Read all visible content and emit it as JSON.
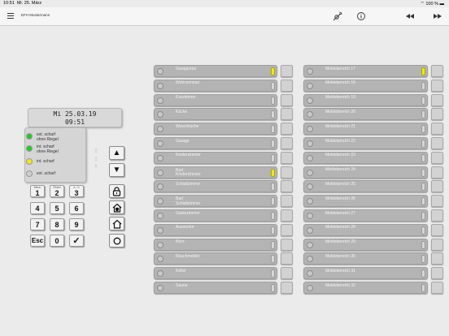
{
  "status_bar": {
    "time": "10:51",
    "date": "Mi. 25. März",
    "battery": "100 %"
  },
  "nav": {
    "title": "EFH Mustermann",
    "icons": [
      "menu-icon",
      "wireless-icon",
      "info-icon",
      "rewind-icon",
      "fast-forward-icon"
    ]
  },
  "lcd": {
    "line1": "Mi 25.03.19",
    "line2": "09:51"
  },
  "status_panel": [
    {
      "label1": "ext. scharf",
      "label2": "ohne Riegel",
      "color": "#22cc22"
    },
    {
      "label1": "int. scharf",
      "label2": "ohne Riegel",
      "color": "#22cc22"
    },
    {
      "label1": "int. scharf",
      "label2": "",
      "color": "#f2e61d"
    },
    {
      "label1": "ext. scharf",
      "label2": "",
      "color": "#cfcfcf"
    }
  ],
  "keypad": {
    "k1": {
      "sub": "Menu",
      "main": "1"
    },
    "k2": {
      "sub": "Reset",
      "main": "2"
    },
    "k3": {
      "sub": "a - b",
      "main": "3"
    },
    "k4": "4",
    "k5": "5",
    "k6": "6",
    "k7": "7",
    "k8": "8",
    "k9": "9",
    "kesc": "Esc",
    "k0": "0",
    "kok": "✓"
  },
  "side_buttons": {
    "up": "▲",
    "down": "▼",
    "lock": "lock-icon",
    "home_shield": "house-shield-icon",
    "home": "house-icon",
    "circle": "circle-icon"
  },
  "zones_left": [
    {
      "label1": "Garagentor",
      "label2": "",
      "indicator": "#f2e61d"
    },
    {
      "label1": "Wohnzimmer",
      "label2": "",
      "indicator": ""
    },
    {
      "label1": "Esszimmer",
      "label2": "",
      "indicator": ""
    },
    {
      "label1": "Küche",
      "label2": "",
      "indicator": ""
    },
    {
      "label1": "Waschküche",
      "label2": "",
      "indicator": ""
    },
    {
      "label1": "Garage",
      "label2": "",
      "indicator": ""
    },
    {
      "label1": "Kinderzimmer",
      "label2": "",
      "indicator": ""
    },
    {
      "label1": "Bad",
      "label2": "Kinderzimmer",
      "indicator": "#f2e61d"
    },
    {
      "label1": "Schlafzimmer",
      "label2": "",
      "indicator": ""
    },
    {
      "label1": "Bad",
      "label2": "Schlafzimmer",
      "indicator": ""
    },
    {
      "label1": "Gästezimmer",
      "label2": "",
      "indicator": ""
    },
    {
      "label1": "Aussentür",
      "label2": "",
      "indicator": ""
    },
    {
      "label1": "Büro",
      "label2": "",
      "indicator": ""
    },
    {
      "label1": "Rauchmelder",
      "label2": "",
      "indicator": ""
    },
    {
      "label1": "Keller",
      "label2": "",
      "indicator": ""
    },
    {
      "label1": "Sauna",
      "label2": "",
      "indicator": ""
    }
  ],
  "zones_right": [
    {
      "label1": "Meldebereich 17",
      "label2": "",
      "indicator": "#f2e61d"
    },
    {
      "label1": "Meldebereich 18",
      "label2": "",
      "indicator": ""
    },
    {
      "label1": "Meldebereich 19",
      "label2": "",
      "indicator": ""
    },
    {
      "label1": "Meldebereich 20",
      "label2": "",
      "indicator": ""
    },
    {
      "label1": "Meldebereich 21",
      "label2": "",
      "indicator": ""
    },
    {
      "label1": "Meldebereich 22",
      "label2": "",
      "indicator": ""
    },
    {
      "label1": "Meldebereich 23",
      "label2": "",
      "indicator": ""
    },
    {
      "label1": "Meldebereich 24",
      "label2": "",
      "indicator": ""
    },
    {
      "label1": "Meldebereich 25",
      "label2": "",
      "indicator": ""
    },
    {
      "label1": "Meldebereich 26",
      "label2": "",
      "indicator": ""
    },
    {
      "label1": "Meldebereich 27",
      "label2": "",
      "indicator": ""
    },
    {
      "label1": "Meldebereich 28",
      "label2": "",
      "indicator": ""
    },
    {
      "label1": "Meldebereich 29",
      "label2": "",
      "indicator": ""
    },
    {
      "label1": "Meldebereich 30",
      "label2": "",
      "indicator": ""
    },
    {
      "label1": "Meldebereich 31",
      "label2": "",
      "indicator": ""
    },
    {
      "label1": "Meldebereich 32",
      "label2": "",
      "indicator": ""
    }
  ]
}
